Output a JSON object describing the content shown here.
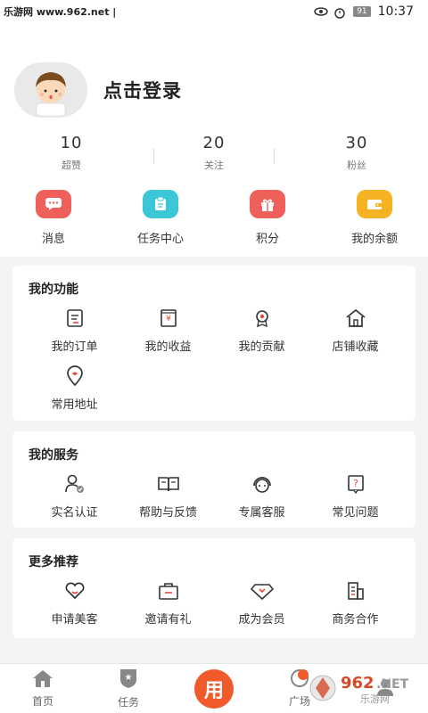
{
  "status_bar": {
    "watermark_text": "乐游网 www.962.net |",
    "battery": "91",
    "time": "10:37"
  },
  "profile": {
    "login_text": "点击登录"
  },
  "stats": [
    {
      "num": "10",
      "label": "超赞"
    },
    {
      "num": "20",
      "label": "关注"
    },
    {
      "num": "30",
      "label": "粉丝"
    }
  ],
  "quick": [
    {
      "label": "消息",
      "icon": "message-icon",
      "color": "#f0605a"
    },
    {
      "label": "任务中心",
      "icon": "task-icon",
      "color": "#3cc7d6"
    },
    {
      "label": "积分",
      "icon": "gift-icon",
      "color": "#f0605a"
    },
    {
      "label": "我的余额",
      "icon": "wallet-icon",
      "color": "#f5b324"
    }
  ],
  "functions": {
    "title": "我的功能",
    "items": [
      {
        "label": "我的订单",
        "icon": "order-icon"
      },
      {
        "label": "我的收益",
        "icon": "income-icon"
      },
      {
        "label": "我的贡献",
        "icon": "badge-icon"
      },
      {
        "label": "店铺收藏",
        "icon": "store-icon"
      },
      {
        "label": "常用地址",
        "icon": "location-icon"
      }
    ]
  },
  "services": {
    "title": "我的服务",
    "items": [
      {
        "label": "实名认证",
        "icon": "user-verify-icon"
      },
      {
        "label": "帮助与反馈",
        "icon": "book-icon"
      },
      {
        "label": "专属客服",
        "icon": "headset-icon"
      },
      {
        "label": "常见问题",
        "icon": "question-icon"
      }
    ]
  },
  "recommend": {
    "title": "更多推荐",
    "items": [
      {
        "label": "申请美客",
        "icon": "heart-icon"
      },
      {
        "label": "邀请有礼",
        "icon": "briefcase-icon"
      },
      {
        "label": "成为会员",
        "icon": "diamond-icon"
      },
      {
        "label": "商务合作",
        "icon": "building-icon"
      }
    ]
  },
  "tabbar": {
    "home": "首页",
    "task": "任务",
    "center": "用",
    "square": "广场"
  },
  "accent": "#f15a2b",
  "watermark_logo": "962.NET 乐游网"
}
